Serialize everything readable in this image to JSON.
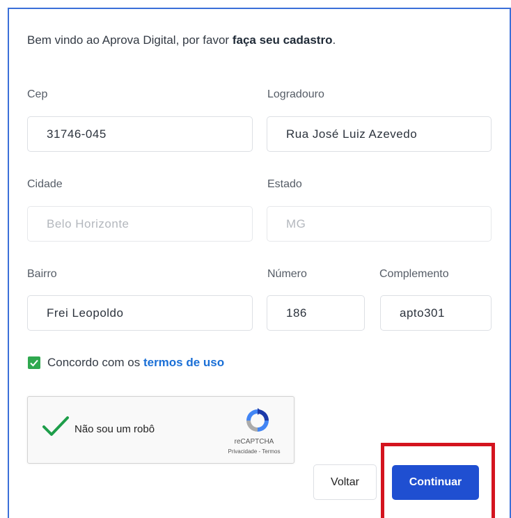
{
  "welcome": {
    "prefix": "Bem vindo ao Aprova Digital, por favor ",
    "emphasis": "faça seu cadastro",
    "suffix": "."
  },
  "form": {
    "cep": {
      "label": "Cep",
      "value": "31746-045"
    },
    "logradouro": {
      "label": "Logradouro",
      "value": "Rua José Luiz Azevedo"
    },
    "cidade": {
      "label": "Cidade",
      "placeholder": "Belo Horizonte"
    },
    "estado": {
      "label": "Estado",
      "placeholder": "MG"
    },
    "bairro": {
      "label": "Bairro",
      "value": "Frei Leopoldo"
    },
    "numero": {
      "label": "Número",
      "value": "186"
    },
    "complemento": {
      "label": "Complemento",
      "value": "apto301"
    }
  },
  "terms": {
    "checked": true,
    "text": "Concordo com os ",
    "link": "termos de uso"
  },
  "captcha": {
    "label": "Não sou um robô",
    "brand": "reCAPTCHA",
    "links": "Privacidade - Termos"
  },
  "actions": {
    "back_label": "Voltar",
    "continue_label": "Continuar"
  },
  "colors": {
    "accent": "#1f4fd1",
    "link": "#1a6fd6",
    "checkbox": "#2fa84f",
    "highlight": "#d4141f",
    "frame": "#3a6fd8"
  }
}
